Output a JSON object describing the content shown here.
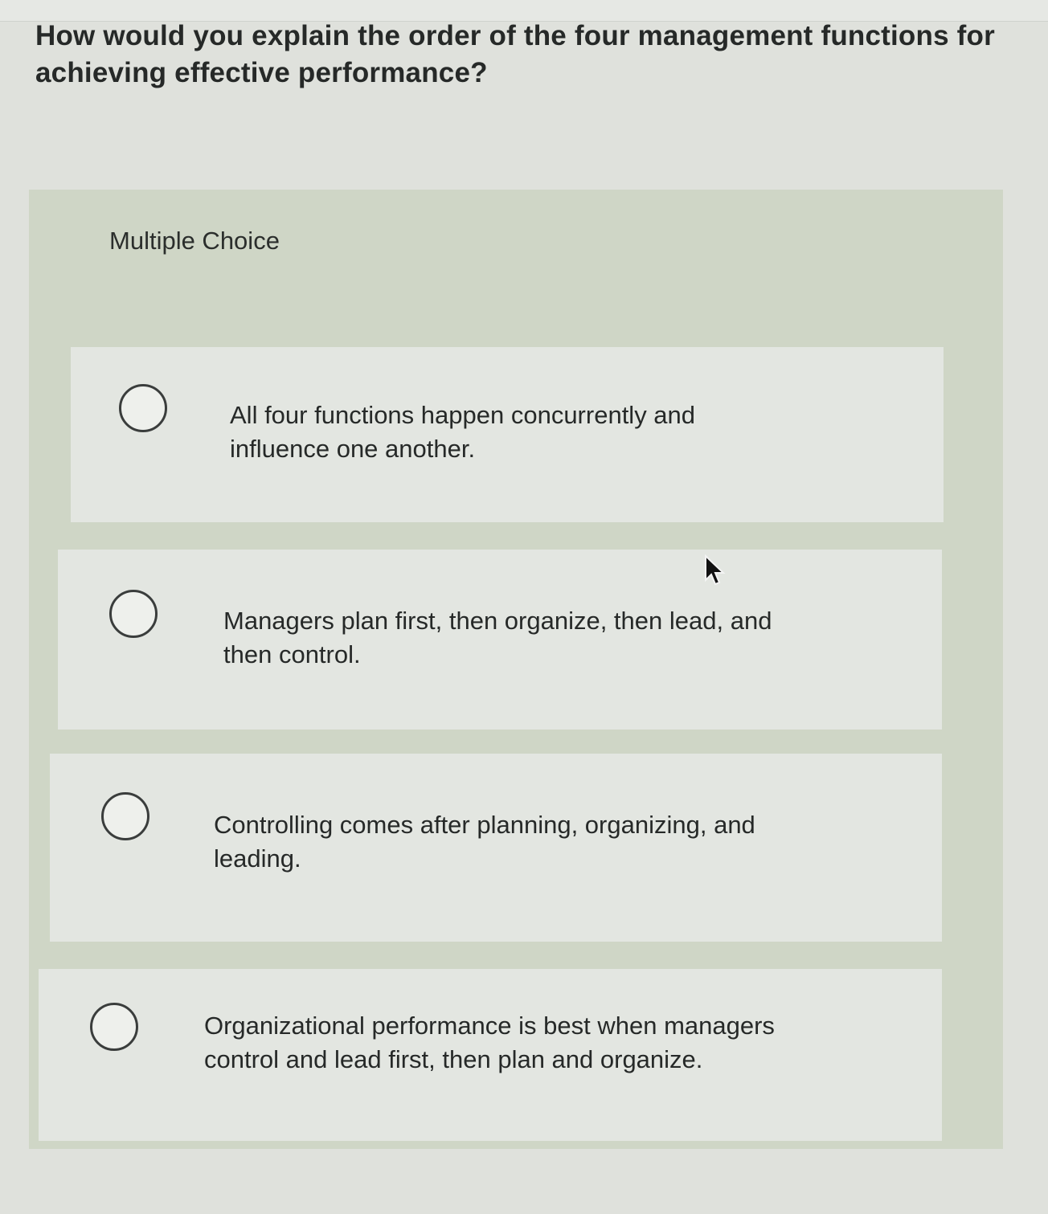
{
  "question": {
    "text": "How would you explain the order of the four management functions for achieving effective performance?"
  },
  "section": {
    "label": "Multiple Choice"
  },
  "options": [
    {
      "text": "All four functions happen concurrently and influence one another.",
      "selected": false
    },
    {
      "text": "Managers plan first, then organize, then lead, and then control.",
      "selected": false
    },
    {
      "text": "Controlling comes after planning, organizing, and leading.",
      "selected": false
    },
    {
      "text": "Organizational performance is best when managers control and lead first, then plan and organize.",
      "selected": false
    }
  ],
  "icons": {
    "radio": "radio-circle-icon",
    "cursor": "mouse-pointer-icon"
  }
}
